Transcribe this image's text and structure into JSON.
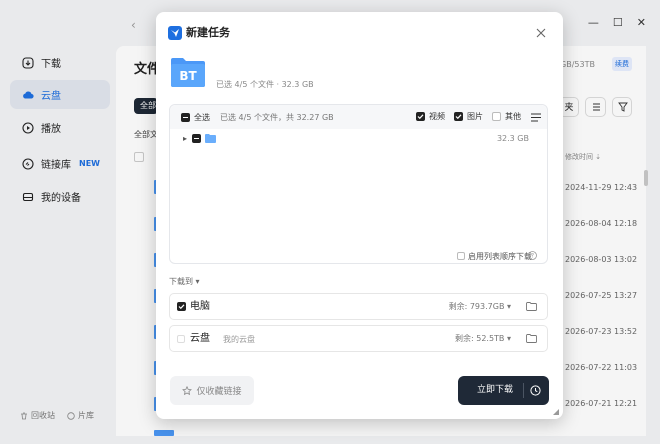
{
  "sidebar": {
    "items": [
      {
        "label": "下载",
        "icon": "download-icon"
      },
      {
        "label": "云盘",
        "icon": "cloud-icon"
      },
      {
        "label": "播放",
        "icon": "play-icon"
      },
      {
        "label": "链接库",
        "icon": "link-icon",
        "badge": "NEW"
      },
      {
        "label": "我的设备",
        "icon": "device-icon"
      }
    ],
    "footer": {
      "recycle": "回收站",
      "share": "片库"
    }
  },
  "background": {
    "title": "文件",
    "chip": "全部",
    "all_files": "全部文",
    "quota": "GB/53TB",
    "renew": "续费",
    "btn_new_folder": "夹",
    "col_modified": "修改时间",
    "dates": [
      "2024-11-29 12:43",
      "2026-08-04 12:18",
      "2026-08-03 13:02",
      "2026-07-25 13:27",
      "2026-07-23 13:52",
      "2026-07-22 11:03",
      "2026-07-21 12:21"
    ]
  },
  "modal": {
    "title": "新建任务",
    "bt_label": "BT",
    "bt_summary": "已选 4/5 个文件 · 32.3 GB",
    "select_all": "全选",
    "selected_summary": "已选 4/5 个文件，共 32.27 GB",
    "filters": [
      {
        "label": "视频",
        "checked": true
      },
      {
        "label": "图片",
        "checked": true
      },
      {
        "label": "其他",
        "checked": false
      }
    ],
    "tree_root_size": "32.3 GB",
    "sequential_label": "启用列表顺序下载",
    "download_to_label": "下载到",
    "destinations": [
      {
        "name": "电脑",
        "sub": "",
        "space": "剩余: 793.7GB",
        "checked": true
      },
      {
        "name": "云盘",
        "sub": "我的云盘",
        "space": "剩余: 52.5TB",
        "checked": false
      }
    ],
    "favorite_button": "仅收藏链接",
    "download_button": "立即下载"
  },
  "colors": {
    "accent": "#1e6fe0",
    "dark_button": "#1f2937",
    "folder": "#4b98f7"
  }
}
